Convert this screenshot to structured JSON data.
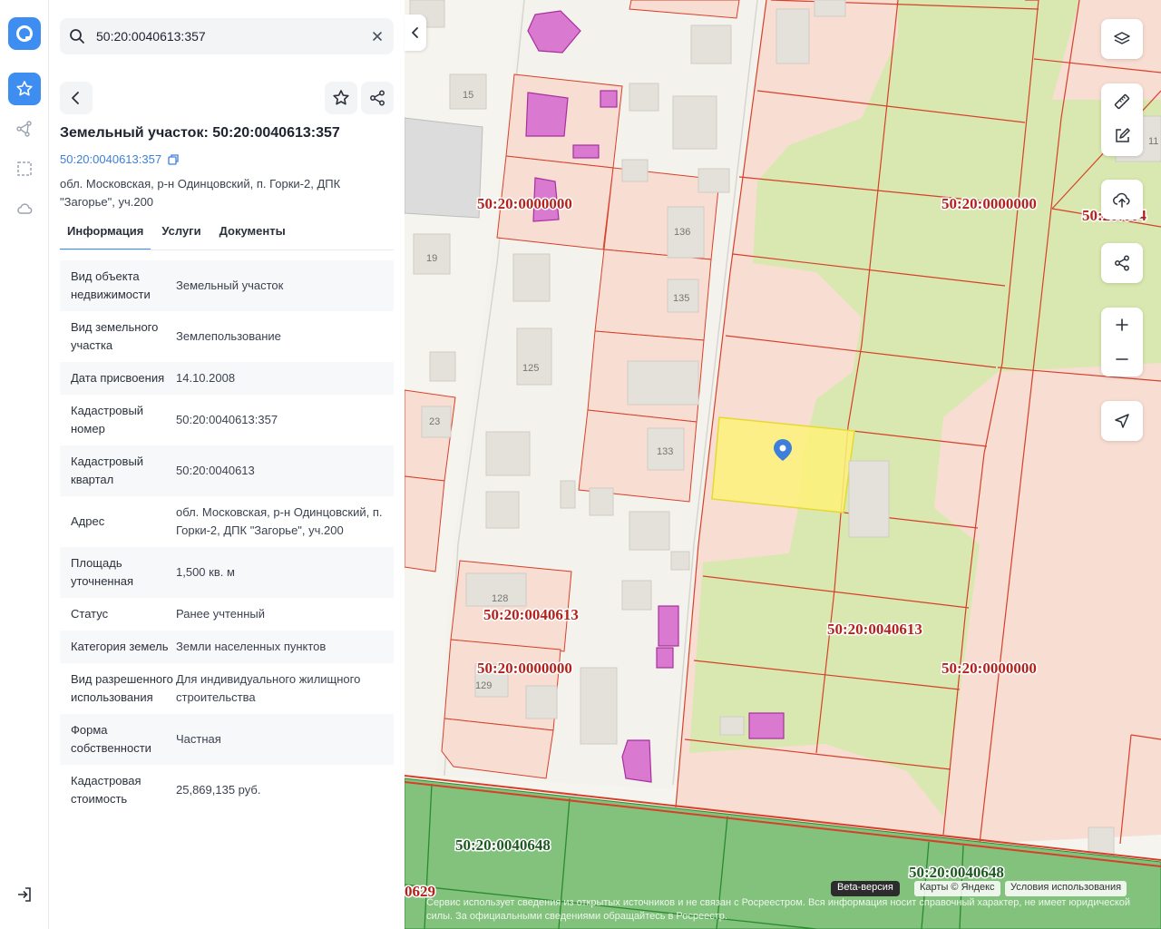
{
  "search": {
    "value": "50:20:0040613:357"
  },
  "parcel": {
    "title": "Земельный участок: 50:20:0040613:357",
    "cadastral_link": "50:20:0040613:357",
    "address": "обл. Московская, р-н Одинцовский, п. Горки-2, ДПК \"Загорье\", уч.200"
  },
  "tabs": [
    {
      "label": "Информация",
      "active": true
    },
    {
      "label": "Услуги",
      "active": false
    },
    {
      "label": "Документы",
      "active": false
    }
  ],
  "info": [
    {
      "key": "Вид объекта недвижимости",
      "value": "Земельный участок"
    },
    {
      "key": "Вид земельного участка",
      "value": "Землепользование"
    },
    {
      "key": "Дата присвоения",
      "value": "14.10.2008"
    },
    {
      "key": "Кадастровый номер",
      "value": "50:20:0040613:357"
    },
    {
      "key": "Кадастровый квартал",
      "value": "50:20:0040613"
    },
    {
      "key": "Адрес",
      "value": "обл. Московская, р-н Одинцовский, п. Горки-2, ДПК \"Загорье\", уч.200"
    },
    {
      "key": "Площадь уточненная",
      "value": "1,500 кв. м"
    },
    {
      "key": "Статус",
      "value": "Ранее учтенный"
    },
    {
      "key": "Категория земель",
      "value": "Земли населенных пунктов"
    },
    {
      "key": "Вид разрешенного использования",
      "value": "Для индивидуального жилищного строительства"
    },
    {
      "key": "Форма собственности",
      "value": "Частная"
    },
    {
      "key": "Кадастровая стоимость",
      "value": "25,869,135 руб."
    }
  ],
  "map": {
    "labels": {
      "q1": "50:20:0000000",
      "q2": "50:20:0000000",
      "q3": "50:20:0040613",
      "q4": "50:20:0000000",
      "q5": "50:20:0040613",
      "q6": "50:20:0000000",
      "q7": "50:20:0040648",
      "q8": "50:20:0040648",
      "q9": "50:20:004",
      "q10": "0629"
    },
    "house_numbers": {
      "h15": "15",
      "h19": "19",
      "h23": "23",
      "h125": "125",
      "h128": "128",
      "h129": "129",
      "h133": "133",
      "h135": "135",
      "h136": "136",
      "h11": "11"
    },
    "beta": "Beta-версия",
    "attribution": "Карты © Яндекс",
    "terms": "Условия использования",
    "disclaimer": "Сервис использует сведения из открытых источников и не связан с Росреестром. Вся информация носит справочный характер, не имеет юридической силы. За официальными сведениями обращайтесь в Росреестр."
  },
  "colors": {
    "accent": "#3d8ef0",
    "parcel_border": "#d6402a",
    "selected": "#fdf27a",
    "green_zone": "#7cc67a"
  }
}
